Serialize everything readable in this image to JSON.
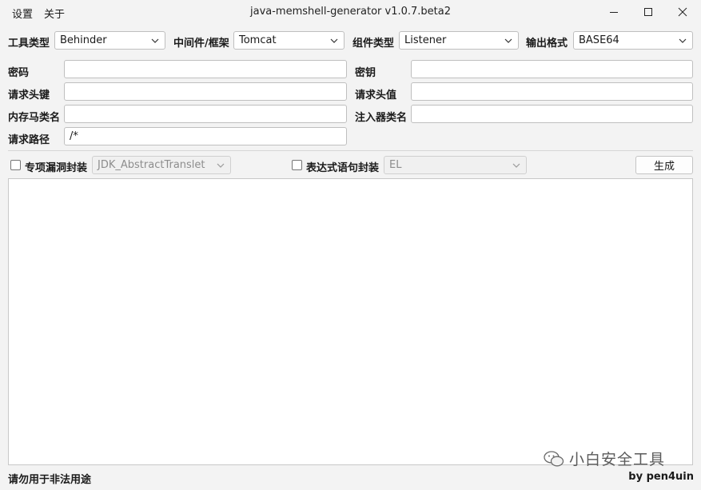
{
  "menu": {
    "settings": "设置",
    "about": "关于"
  },
  "window": {
    "title": "java-memshell-generator v1.0.7.beta2"
  },
  "row1": {
    "tool_label": "工具类型",
    "tool_value": "Behinder",
    "server_label": "中间件/框架",
    "server_value": "Tomcat",
    "component_label": "组件类型",
    "component_value": "Listener",
    "format_label": "输出格式",
    "format_value": "BASE64"
  },
  "fields": {
    "password_label": "密码",
    "password_value": "",
    "key_label": "密钥",
    "key_value": "",
    "header_key_label": "请求头键",
    "header_key_value": "",
    "header_value_label": "请求头值",
    "header_value_value": "",
    "shell_class_label": "内存马类名",
    "shell_class_value": "",
    "injector_class_label": "注入器类名",
    "injector_class_value": "",
    "path_label": "请求路径",
    "path_value": "/*"
  },
  "options": {
    "gadget_label": "专项漏洞封装",
    "gadget_value": "JDK_AbstractTranslet",
    "gadget_checked": false,
    "expr_label": "表达式语句封装",
    "expr_value": "EL",
    "expr_checked": false,
    "generate_label": "生成"
  },
  "output": {
    "content": ""
  },
  "status": {
    "left": "请勿用于非法用途",
    "right": "by pen4uin"
  },
  "watermark": {
    "text": "小白安全工具"
  },
  "colors": {
    "background": "#f3f3f3",
    "border": "#bfbfbf",
    "disabled_text": "#8d8d8d"
  }
}
